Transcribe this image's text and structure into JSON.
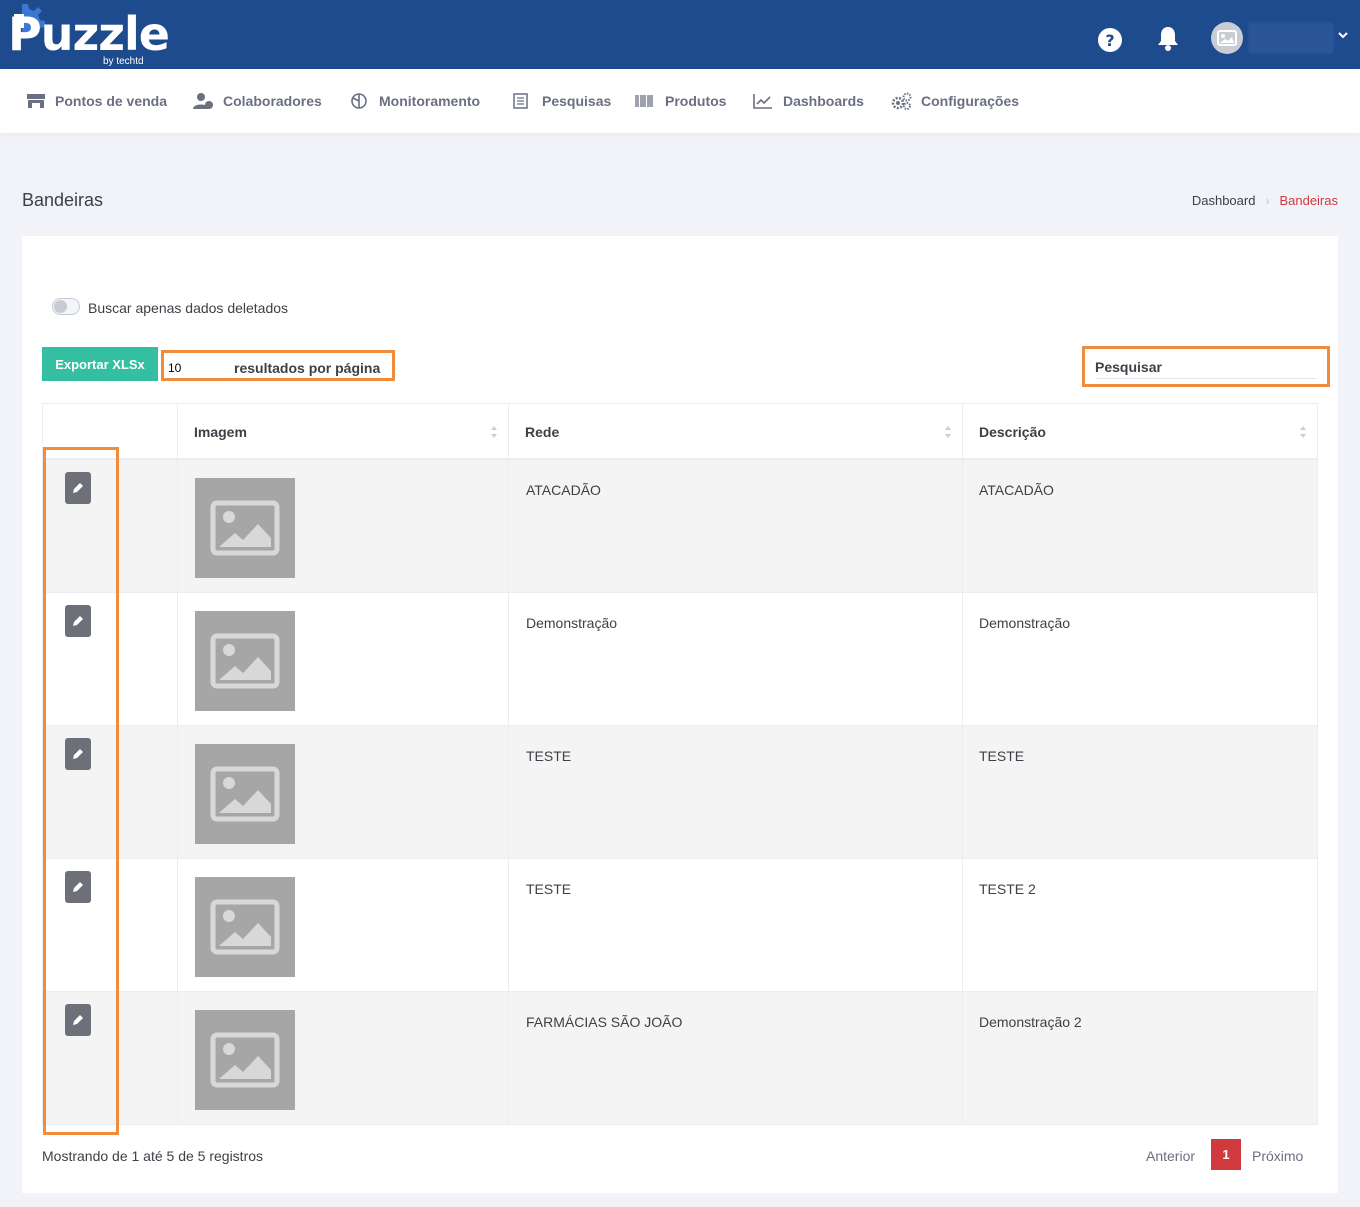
{
  "header": {
    "logo_text": "Puzzle",
    "logo_sub": "by techtd",
    "help_icon": "help-circle-icon",
    "bell_icon": "bell-icon",
    "user_chevron_icon": "chevron-down-icon"
  },
  "nav": {
    "items": [
      {
        "label": "Pontos de venda",
        "icon": "store-icon"
      },
      {
        "label": "Colaboradores",
        "icon": "users-icon"
      },
      {
        "label": "Monitoramento",
        "icon": "monitor-icon"
      },
      {
        "label": "Pesquisas",
        "icon": "survey-icon"
      },
      {
        "label": "Produtos",
        "icon": "barcode-icon"
      },
      {
        "label": "Dashboards",
        "icon": "chart-line-icon"
      },
      {
        "label": "Configurações",
        "icon": "gears-icon"
      }
    ]
  },
  "page": {
    "title": "Bandeiras",
    "breadcrumb_home": "Dashboard",
    "breadcrumb_current": "Bandeiras"
  },
  "controls": {
    "toggle_label": "Buscar apenas dados deletados",
    "export_label": "Exportar XLSx",
    "per_page_value": "10",
    "per_page_label": "resultados por página",
    "search_placeholder": "Pesquisar"
  },
  "table": {
    "columns": [
      "",
      "Imagem",
      "Rede",
      "Descrição"
    ],
    "rows": [
      {
        "rede": "ATACADÃO",
        "descricao": "ATACADÃO"
      },
      {
        "rede": "Demonstração",
        "descricao": "Demonstração"
      },
      {
        "rede": "TESTE",
        "descricao": "TESTE"
      },
      {
        "rede": "TESTE",
        "descricao": "TESTE 2"
      },
      {
        "rede": "FARMÁCIAS SÃO JOÃO",
        "descricao": "Demonstração 2"
      }
    ]
  },
  "footer": {
    "info": "Mostrando de 1 até 5 de 5 registros",
    "prev": "Anterior",
    "current_page": "1",
    "next": "Próximo"
  },
  "colors": {
    "header_bg": "#1e4a8e",
    "accent": "#d0393e",
    "export": "#34bfa3",
    "highlight": "#f08c3c"
  }
}
